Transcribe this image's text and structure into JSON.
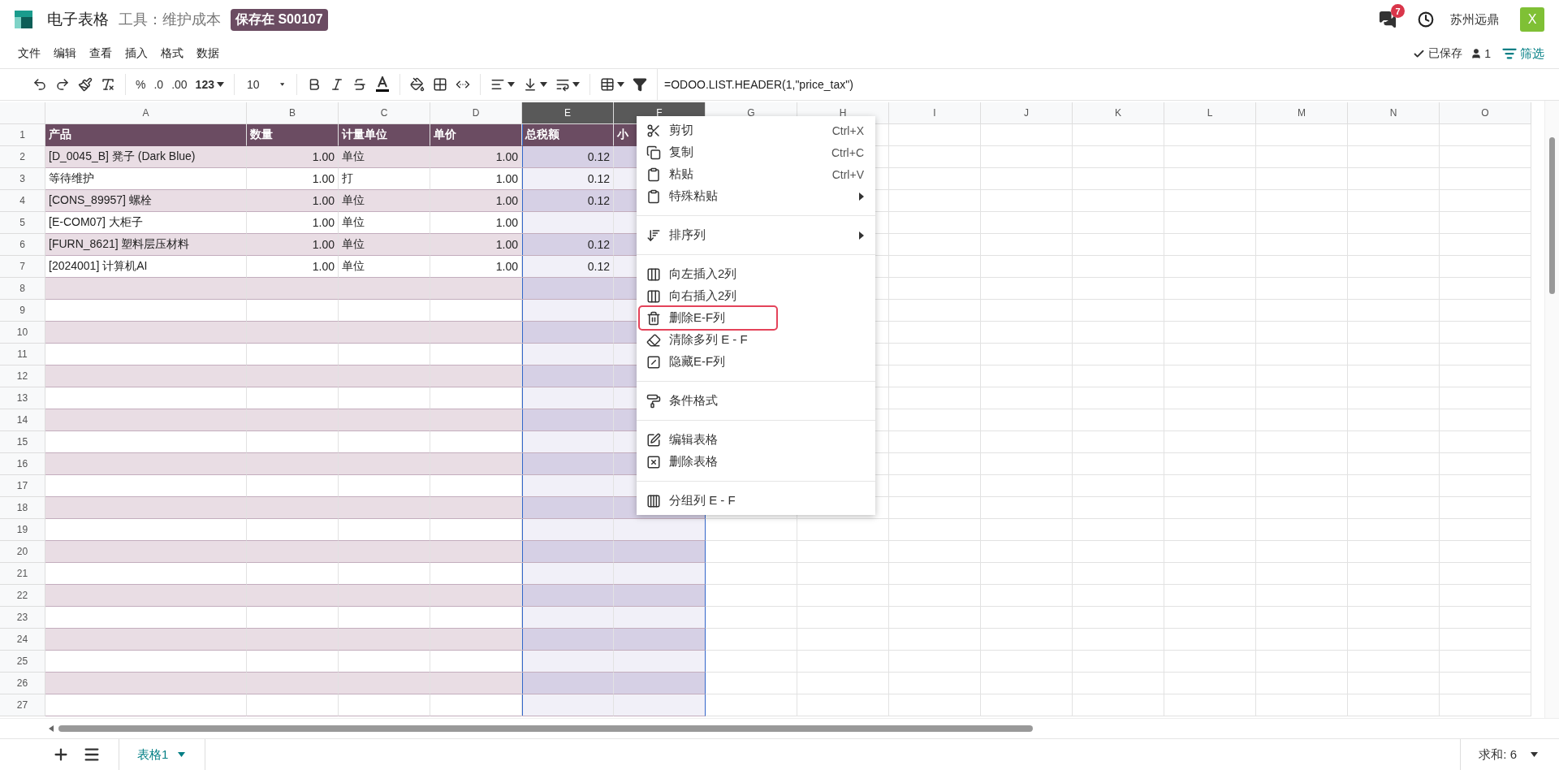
{
  "app": {
    "title": "电子表格",
    "subtitle": "工具：维护成本",
    "badge": "保存在 S00107"
  },
  "header_right": {
    "messages_count": "7",
    "company": "苏州远鼎",
    "avatar": "X"
  },
  "menu": [
    "文件",
    "编辑",
    "查看",
    "插入",
    "格式",
    "数据"
  ],
  "status": {
    "saved": "已保存",
    "users": "1",
    "filter": "筛选"
  },
  "toolbar": {
    "number_formats": [
      "%",
      ".0",
      ".00",
      "123"
    ],
    "font_size": "10",
    "formula": "=ODOO.LIST.HEADER(1,\"price_tax\")"
  },
  "columns": [
    {
      "label": "A",
      "selected": false,
      "kind": "text",
      "in_table": true
    },
    {
      "label": "B",
      "selected": false,
      "kind": "number",
      "in_table": true
    },
    {
      "label": "C",
      "selected": false,
      "kind": "text",
      "in_table": true
    },
    {
      "label": "D",
      "selected": false,
      "kind": "number",
      "in_table": true
    },
    {
      "label": "E",
      "selected": true,
      "kind": "number",
      "in_table": true
    },
    {
      "label": "F",
      "selected": true,
      "kind": "text",
      "in_table": true
    },
    {
      "label": "G",
      "selected": false,
      "kind": "text",
      "in_table": false
    },
    {
      "label": "H",
      "selected": false,
      "kind": "text",
      "in_table": false
    },
    {
      "label": "I",
      "selected": false,
      "kind": "text",
      "in_table": false
    },
    {
      "label": "J",
      "selected": false,
      "kind": "text",
      "in_table": false
    },
    {
      "label": "K",
      "selected": false,
      "kind": "text",
      "in_table": false
    },
    {
      "label": "L",
      "selected": false,
      "kind": "text",
      "in_table": false
    },
    {
      "label": "M",
      "selected": false,
      "kind": "text",
      "in_table": false
    },
    {
      "label": "N",
      "selected": false,
      "kind": "text",
      "in_table": false
    },
    {
      "label": "O",
      "selected": false,
      "kind": "text",
      "in_table": false
    }
  ],
  "rows": [
    {
      "number": "1",
      "kind": "header",
      "cells": [
        "产品",
        "数量",
        "计量单位",
        "单价",
        "总税额",
        "小"
      ]
    },
    {
      "number": "2",
      "kind": "data",
      "cells": [
        "[D_0045_B] 凳子 (Dark Blue)",
        "1.00",
        "单位",
        "1.00",
        "0.12"
      ]
    },
    {
      "number": "3",
      "kind": "data",
      "cells": [
        "等待维护",
        "1.00",
        "打",
        "1.00",
        "0.12"
      ]
    },
    {
      "number": "4",
      "kind": "data",
      "cells": [
        "[CONS_89957] 螺栓",
        "1.00",
        "单位",
        "1.00",
        "0.12"
      ]
    },
    {
      "number": "5",
      "kind": "data",
      "cells": [
        "[E-COM07] 大柜子",
        "1.00",
        "单位",
        "1.00"
      ]
    },
    {
      "number": "6",
      "kind": "data",
      "cells": [
        "[FURN_8621] 塑料层压材料",
        "1.00",
        "单位",
        "1.00",
        "0.12"
      ]
    },
    {
      "number": "7",
      "kind": "data",
      "cells": [
        "[2024001] 计算机AI",
        "1.00",
        "单位",
        "1.00",
        "0.12"
      ]
    },
    {
      "number": "8",
      "kind": "data"
    },
    {
      "number": "9",
      "kind": "data"
    },
    {
      "number": "10",
      "kind": "data"
    },
    {
      "number": "11",
      "kind": "data"
    },
    {
      "number": "12",
      "kind": "data"
    },
    {
      "number": "13",
      "kind": "data"
    },
    {
      "number": "14",
      "kind": "data"
    },
    {
      "number": "15",
      "kind": "data"
    },
    {
      "number": "16",
      "kind": "data"
    },
    {
      "number": "17",
      "kind": "data"
    },
    {
      "number": "18",
      "kind": "data"
    },
    {
      "number": "19",
      "kind": "data"
    },
    {
      "number": "20",
      "kind": "data"
    },
    {
      "number": "21",
      "kind": "data"
    },
    {
      "number": "22",
      "kind": "data"
    },
    {
      "number": "23",
      "kind": "data"
    },
    {
      "number": "24",
      "kind": "data"
    },
    {
      "number": "25",
      "kind": "data"
    },
    {
      "number": "26",
      "kind": "data"
    },
    {
      "number": "27",
      "kind": "data"
    }
  ],
  "context_menu": {
    "groups": [
      [
        {
          "kind": "cut",
          "label": "剪切",
          "shortcut": "Ctrl+X",
          "has_submenu": false,
          "highlighted": false
        },
        {
          "kind": "copy",
          "label": "复制",
          "shortcut": "Ctrl+C",
          "has_submenu": false,
          "highlighted": false
        },
        {
          "kind": "paste",
          "label": "粘贴",
          "shortcut": "Ctrl+V",
          "has_submenu": false,
          "highlighted": false
        },
        {
          "kind": "paste",
          "label": "特殊粘贴",
          "has_submenu": true,
          "highlighted": false
        }
      ],
      [
        {
          "kind": "sort",
          "label": "排序列",
          "has_submenu": true,
          "highlighted": false
        }
      ],
      [
        {
          "kind": "insert",
          "label": "向左插入2列",
          "has_submenu": false,
          "highlighted": false
        },
        {
          "kind": "insert",
          "label": "向右插入2列",
          "has_submenu": false,
          "highlighted": false
        },
        {
          "kind": "delete",
          "label": "删除E-F列",
          "has_submenu": false,
          "highlighted": true
        },
        {
          "kind": "clear",
          "label": "清除多列 E - F",
          "has_submenu": false,
          "highlighted": false
        },
        {
          "kind": "hide",
          "label": "隐藏E-F列",
          "has_submenu": false,
          "highlighted": false
        }
      ],
      [
        {
          "kind": "format",
          "label": "条件格式",
          "has_submenu": false,
          "highlighted": false
        }
      ],
      [
        {
          "kind": "edit_table",
          "label": "编辑表格",
          "has_submenu": false,
          "highlighted": false
        },
        {
          "kind": "delete_table",
          "label": "删除表格",
          "has_submenu": false,
          "highlighted": false
        }
      ],
      [
        {
          "kind": "group",
          "label": "分组列 E - F",
          "has_submenu": false,
          "highlighted": false
        }
      ]
    ]
  },
  "sheet_tabs": [
    {
      "label": "表格1",
      "selected": true
    }
  ],
  "aggregate": "求和: 6"
}
